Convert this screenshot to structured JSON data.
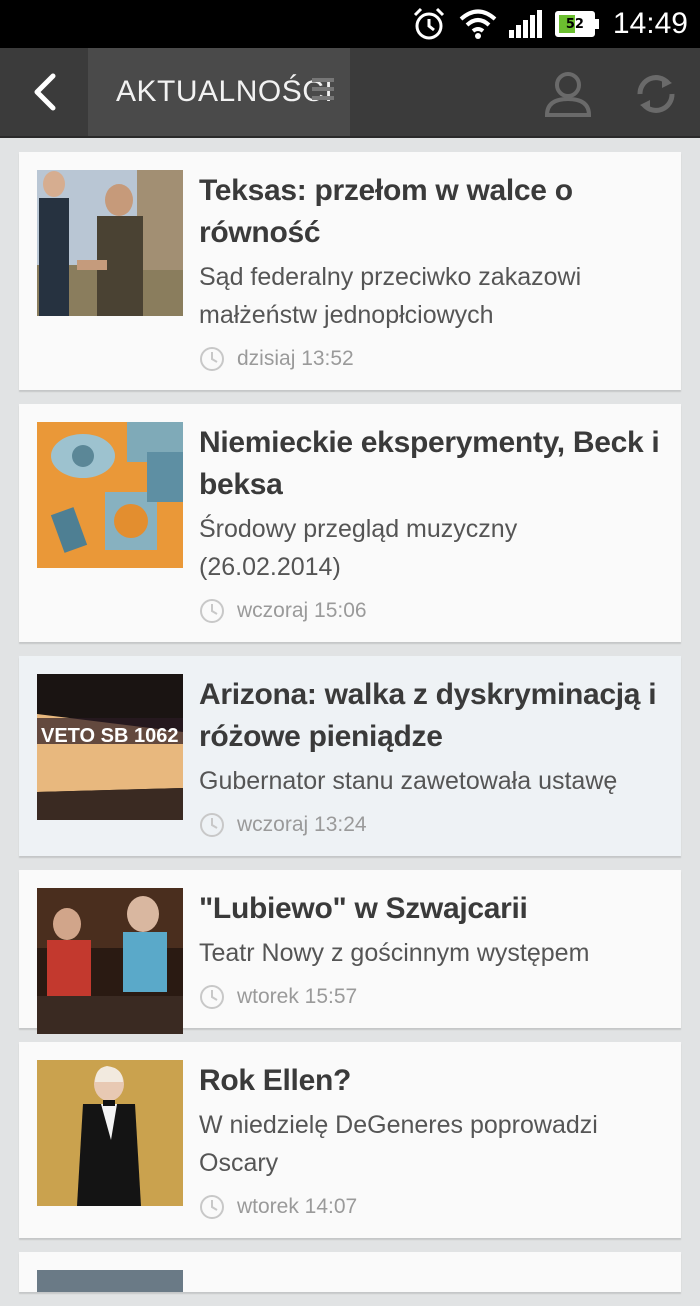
{
  "status": {
    "time": "14:49",
    "battery": "52"
  },
  "appbar": {
    "title": "AKTUALNOŚCI"
  },
  "articles": [
    {
      "title": "Teksas: przełom w walce o równość",
      "subtitle": "Sąd federalny przeciwko zakazowi małżeństw jednopłciowych",
      "time": "dzisiaj 13:52",
      "image": "two-men-photo"
    },
    {
      "title": "Niemieckie eksperymenty, Beck i beksa",
      "subtitle": "Środowy przegląd muzyczny (26.02.2014)",
      "time": "wczoraj 15:06",
      "image": "orange-collage-image"
    },
    {
      "title": "Arizona: walka z dyskryminacją i różowe pieniądze",
      "subtitle": "Gubernator stanu zawetowała ustawę",
      "time": "wczoraj 13:24",
      "image": "veto-sign-photo",
      "img_text": "VETO SB 1062"
    },
    {
      "title": "\"Lubiewo\" w Szwajcarii",
      "subtitle": "Teatr Nowy z gościnnym występem",
      "time": "wtorek 15:57",
      "image": "theatre-stage-photo"
    },
    {
      "title": "Rok Ellen?",
      "subtitle": "W niedzielę DeGeneres poprowadzi Oscary",
      "time": "wtorek 14:07",
      "image": "ellen-photo"
    }
  ]
}
